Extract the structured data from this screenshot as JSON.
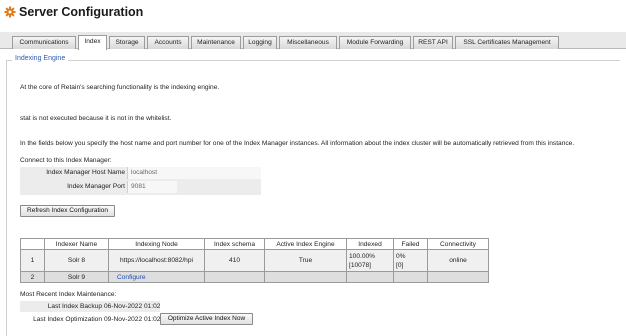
{
  "app": {
    "title": "Server Configuration",
    "icon": "gear-icon",
    "accent": "#e07b1a"
  },
  "tabs": [
    {
      "label": "Communications",
      "active": false
    },
    {
      "label": "Index",
      "active": true
    },
    {
      "label": "Storage",
      "active": false
    },
    {
      "label": "Accounts",
      "active": false
    },
    {
      "label": "Maintenance",
      "active": false
    },
    {
      "label": "Logging",
      "active": false
    },
    {
      "label": "Miscellaneous",
      "active": false
    },
    {
      "label": "Module Forwarding",
      "active": false
    },
    {
      "label": "REST API",
      "active": false
    },
    {
      "label": "SSL Certificates Management",
      "active": false
    }
  ],
  "section": {
    "legend": "Indexing Engine",
    "intro": "At the core of Retain's searching functionality is the indexing engine.",
    "warning": "stat is not executed because it is not in the whitelist.",
    "instructions": "In the fields below you specify the host name and port number for one of the Index Manager instances. All information about the index cluster will be automatically retrieved from this instance.",
    "connect_label": "Connect to this Index Manager:"
  },
  "form": {
    "host_label": "Index Manager Host Name",
    "host_value": "localhost",
    "port_label": "Index Manager Port",
    "port_value": "9081"
  },
  "refresh_button": "Refresh Index Configuration",
  "index_table": {
    "headers": [
      "",
      "Indexer Name",
      "Indexing Node",
      "Index schema",
      "Active Index Engine",
      "Indexed",
      "Failed",
      "Connectivity"
    ],
    "rows": [
      {
        "num": "1",
        "name": "Solr 8",
        "node": "https://localhost:8082/hpi",
        "schema": "410",
        "active": "True",
        "indexed_pct": "100.00%",
        "indexed_count": "[10078]",
        "failed_pct": "0%",
        "failed_count": "[0]",
        "connectivity": "online"
      },
      {
        "num": "2",
        "name": "Solr 9",
        "node": "Configure",
        "schema": "",
        "active": "",
        "indexed_pct": "",
        "indexed_count": "",
        "failed_pct": "",
        "failed_count": "",
        "connectivity": ""
      }
    ]
  },
  "maintenance": {
    "heading": "Most Recent Index Maintenance:",
    "backup_label": "Last Index Backup",
    "backup_value": "06-Nov-2022 01:02",
    "optimization_label": "Last Index Optimization",
    "optimization_value": "09-Nov-2022 01:02",
    "optimize_button": "Optimize Active Index Now"
  }
}
